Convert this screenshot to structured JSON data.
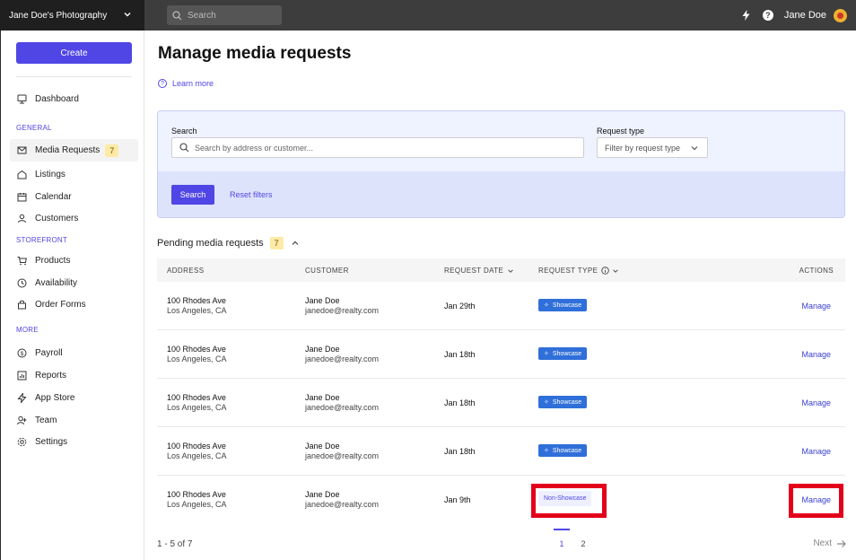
{
  "app": {
    "org_name": "Jane Doe's Photography",
    "search_placeholder": "Search",
    "user_name": "Jane Doe"
  },
  "sidebar": {
    "create_label": "Create",
    "dashboard": "Dashboard",
    "section_general": "GENERAL",
    "media_requests": "Media Requests",
    "media_requests_count": "7",
    "listings": "Listings",
    "calendar": "Calendar",
    "customers": "Customers",
    "section_storefront": "STOREFRONT",
    "products": "Products",
    "availability": "Availability",
    "order_forms": "Order Forms",
    "section_more": "MORE",
    "payroll": "Payroll",
    "reports": "Reports",
    "app_store": "App Store",
    "team": "Team",
    "settings": "Settings"
  },
  "main": {
    "title": "Manage media requests",
    "learn_more": "Learn more",
    "filters": {
      "search_label": "Search",
      "search_placeholder": "Search by address or customer...",
      "type_label": "Request type",
      "type_placeholder": "Filter by request type",
      "search_button": "Search",
      "reset_button": "Reset filters"
    },
    "pending": {
      "label": "Pending media requests",
      "count": "7"
    },
    "table": {
      "headers": {
        "address": "ADDRESS",
        "customer": "CUSTOMER",
        "request_date": "REQUEST DATE",
        "request_type": "REQUEST TYPE",
        "actions": "ACTIONS"
      },
      "rows": [
        {
          "street": "100 Rhodes Ave",
          "city": "Los Angeles, CA",
          "name": "Jane Doe",
          "email": "janedoe@realty.com",
          "date": "Jan 29th",
          "type": "Showcase",
          "action": "Manage"
        },
        {
          "street": "100 Rhodes Ave",
          "city": "Los Angeles, CA",
          "name": "Jane Doe",
          "email": "janedoe@realty.com",
          "date": "Jan 18th",
          "type": "Showcase",
          "action": "Manage"
        },
        {
          "street": "100 Rhodes Ave",
          "city": "Los Angeles, CA",
          "name": "Jane Doe",
          "email": "janedoe@realty.com",
          "date": "Jan 18th",
          "type": "Showcase",
          "action": "Manage"
        },
        {
          "street": "100 Rhodes Ave",
          "city": "Los Angeles, CA",
          "name": "Jane Doe",
          "email": "janedoe@realty.com",
          "date": "Jan 18th",
          "type": "Showcase",
          "action": "Manage"
        },
        {
          "street": "100 Rhodes Ave",
          "city": "Los Angeles, CA",
          "name": "Jane Doe",
          "email": "janedoe@realty.com",
          "date": "Jan 9th",
          "type": "Non-Showcase",
          "action": "Manage"
        }
      ]
    },
    "pagination": {
      "range": "1 - 5 of 7",
      "page1": "1",
      "page2": "2",
      "next": "Next"
    }
  },
  "colors": {
    "accent": "#5046e5",
    "showcase_tag": "#2f6fd9",
    "highlight": "#e3001b",
    "badge": "#fdeaa6"
  }
}
